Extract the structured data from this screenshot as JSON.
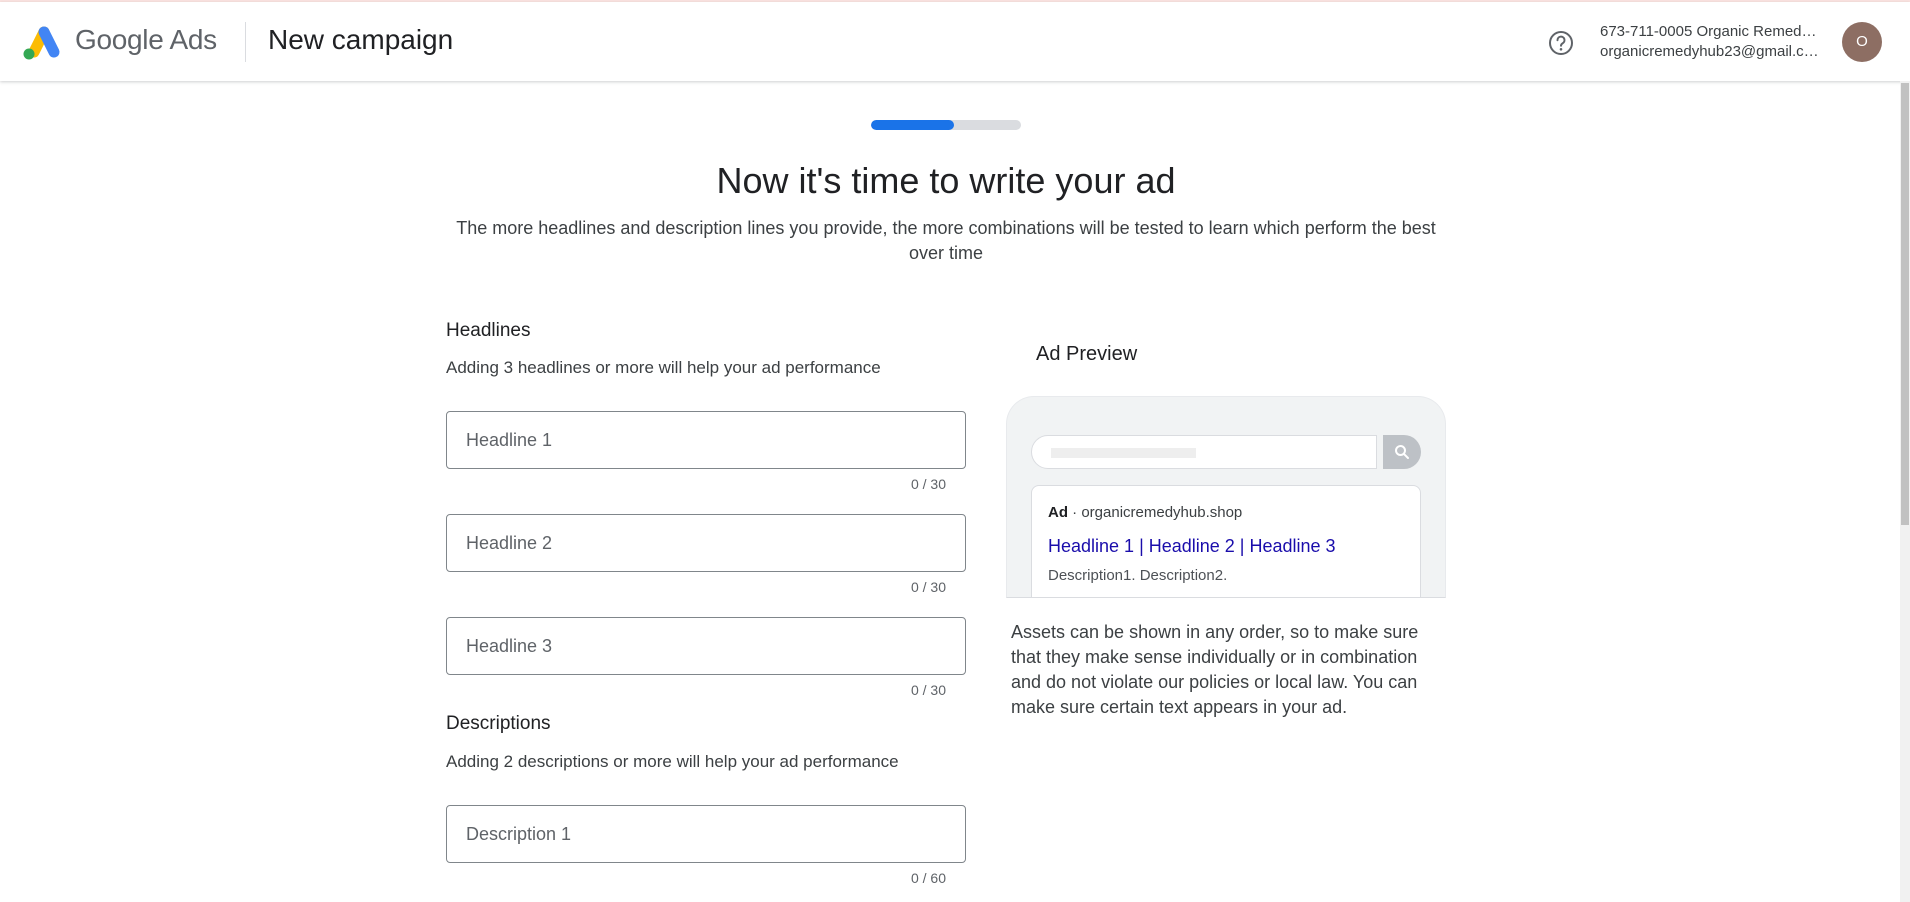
{
  "header": {
    "brand_google": "Google",
    "brand_ads": "Ads",
    "page_title": "New campaign",
    "account_line1": "673-711-0005 Organic Remed…",
    "account_line2": "organicremedyhub23@gmail.c…",
    "avatar_letter": "O",
    "icons": {
      "logo": "google-ads-logo",
      "help": "help-circle-icon"
    }
  },
  "progress": {
    "fraction": 0.55,
    "color": "#1a73e8"
  },
  "main": {
    "title": "Now it's time to write your ad",
    "subtitle": "The more headlines and description lines you provide, the more combinations will be tested to learn which perform the best over time"
  },
  "headlines": {
    "title": "Headlines",
    "help": "Adding 3 headlines or more will help your ad performance",
    "fields": [
      {
        "placeholder": "Headline 1",
        "value": "",
        "counter": "0 / 30"
      },
      {
        "placeholder": "Headline 2",
        "value": "",
        "counter": "0 / 30"
      },
      {
        "placeholder": "Headline 3",
        "value": "",
        "counter": "0 / 30"
      }
    ]
  },
  "descriptions": {
    "title": "Descriptions",
    "help": "Adding 2 descriptions or more will help your ad performance",
    "fields": [
      {
        "placeholder": "Description 1",
        "value": "",
        "counter": "0 / 60"
      }
    ]
  },
  "preview": {
    "title": "Ad Preview",
    "ad_label": "Ad",
    "separator": "·",
    "domain": "organicremedyhub.shop",
    "headline": "Headline 1 | Headline 2 | Headline 3",
    "description": "Description1. Description2.",
    "note": "Assets can be shown in any order, so to make sure that they make sense individually or in combination and do not violate our policies or local law. You can make sure certain text appears in your ad.",
    "icons": {
      "search": "search-icon"
    }
  },
  "colors": {
    "accent": "#1a73e8",
    "ad_headline": "#1a0dab",
    "avatar": "#8d6e63"
  }
}
